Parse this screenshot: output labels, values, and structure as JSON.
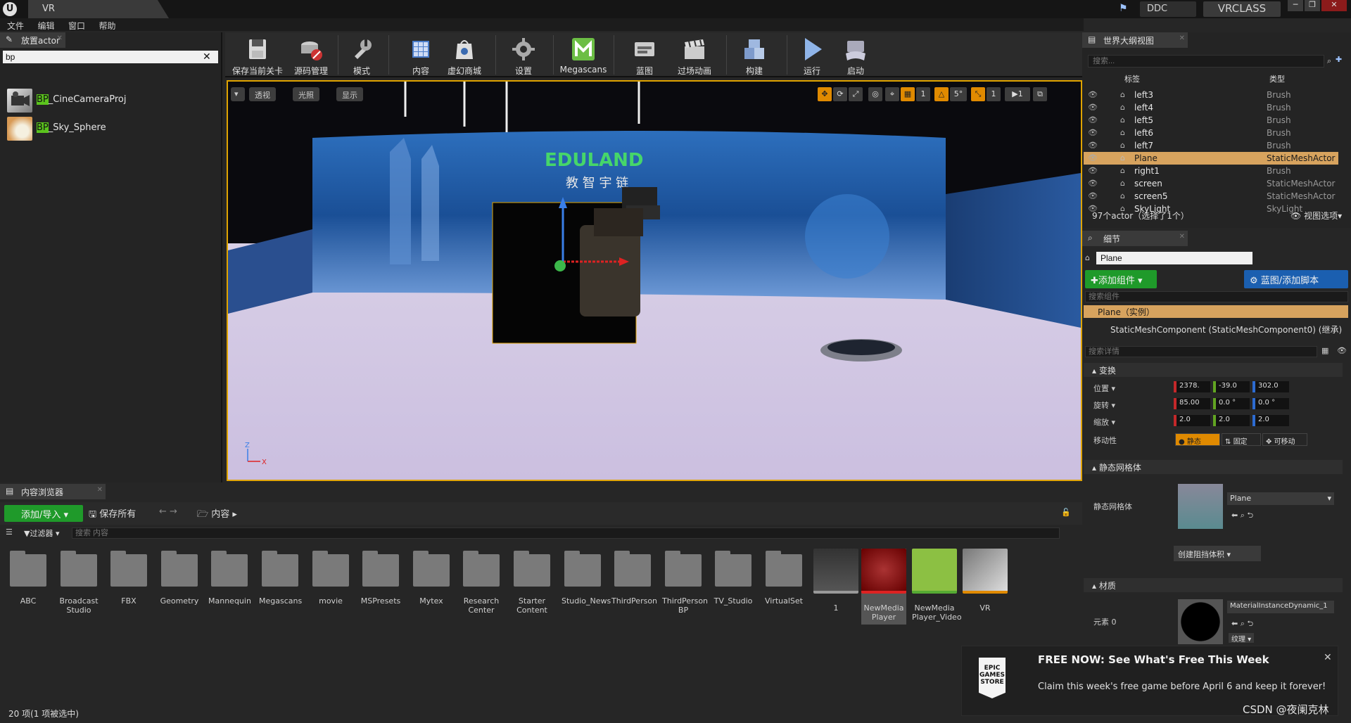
{
  "titlebar": {
    "doc_tab": "VR",
    "ddc_label": "DDC",
    "project_label": "VRCLASS",
    "min": "─",
    "max": "❐",
    "close": "✕"
  },
  "menu": [
    "文件",
    "编辑",
    "窗口",
    "帮助"
  ],
  "place_actor": {
    "tab_label": "放置actor",
    "search_value": "bp",
    "items": [
      {
        "prefix": "BP",
        "rest": "_CineCameraProj"
      },
      {
        "prefix": "BP",
        "rest": "_Sky_Sphere"
      }
    ]
  },
  "toolbar": {
    "items": [
      {
        "label": "保存当前关卡"
      },
      {
        "label": "源码管理"
      },
      {
        "label": "模式"
      },
      {
        "label": "内容"
      },
      {
        "label": "虚幻商城"
      },
      {
        "label": "设置"
      },
      {
        "label": "Megascans"
      },
      {
        "label": "蓝图"
      },
      {
        "label": "过场动画"
      },
      {
        "label": "构建"
      },
      {
        "label": "运行"
      },
      {
        "label": "启动"
      }
    ]
  },
  "viewport": {
    "perspective": "透视",
    "lighting": "光照",
    "show": "显示",
    "angle_snap": "5°",
    "grid_num": "1",
    "cam_speed": "1",
    "axis_x": "X",
    "axis_z": "Z",
    "backdrop_text": "EDULAND",
    "backdrop_sub": "教 智 宇 链"
  },
  "content_browser": {
    "tab_label": "内容浏览器",
    "add_import": "添加/导入",
    "save_all": "保存所有",
    "path": "内容",
    "filter": "过滤器",
    "search_placeholder": "搜索 内容",
    "folders": [
      [
        "ABC"
      ],
      [
        "Broadcast",
        "Studio"
      ],
      [
        "FBX"
      ],
      [
        "Geometry"
      ],
      [
        "Mannequin"
      ],
      [
        "Megascans"
      ],
      [
        "movie"
      ],
      [
        "MSPresets"
      ],
      [
        "Mytex"
      ],
      [
        "Research",
        "Center"
      ],
      [
        "Starter",
        "Content"
      ],
      [
        "Studio_News"
      ],
      [
        "ThirdPerson"
      ],
      [
        "ThirdPerson",
        "BP"
      ],
      [
        "TV_Studio"
      ],
      [
        "VirtualSet"
      ]
    ],
    "assets": [
      {
        "label": [
          "1"
        ]
      },
      {
        "label": [
          "NewMedia",
          "Player"
        ]
      },
      {
        "label": [
          "NewMedia",
          "Player_Video"
        ]
      },
      {
        "label": [
          "VR"
        ]
      }
    ],
    "status": "20 项(1 项被选中)"
  },
  "outliner": {
    "tab_label": "世界大纲视图",
    "search_placeholder": "搜索...",
    "col_label": "标签",
    "col_type": "类型",
    "rows": [
      {
        "name": "left3",
        "type": "Brush"
      },
      {
        "name": "left4",
        "type": "Brush"
      },
      {
        "name": "left5",
        "type": "Brush"
      },
      {
        "name": "left6",
        "type": "Brush"
      },
      {
        "name": "left7",
        "type": "Brush"
      },
      {
        "name": "Plane",
        "type": "StaticMeshActor",
        "selected": true
      },
      {
        "name": "right1",
        "type": "Brush"
      },
      {
        "name": "screen",
        "type": "StaticMeshActor"
      },
      {
        "name": "screen5",
        "type": "StaticMeshActor"
      },
      {
        "name": "SkyLight",
        "type": "SkyLight"
      }
    ],
    "count": "97个actor（选择了1个）",
    "view_options": "视图选项"
  },
  "details": {
    "tab_label": "细节",
    "name_value": "Plane",
    "add_component": "添加组件",
    "blueprint_script": "蓝图/添加脚本",
    "component_search": "搜索组件",
    "instance": "Plane（实例）",
    "component": "StaticMeshComponent (StaticMeshComponent0) (继承)",
    "detail_search": "搜索详情",
    "transform_section": "变换",
    "location_label": "位置",
    "rotation_label": "旋转",
    "scale_label": "缩放",
    "mobility_label": "移动性",
    "location": [
      "2378.",
      "-39.0",
      "302.0"
    ],
    "rotation": [
      "85.00",
      "0.0 °",
      "0.0 °"
    ],
    "scale": [
      "2.0",
      "2.0",
      "2.0"
    ],
    "mobility": [
      "静态",
      "固定",
      "可移动"
    ],
    "static_mesh_section": "静态网格体",
    "static_mesh_label": "静态网格体",
    "static_mesh_value": "Plane",
    "create_volume": "创建阻挡体积",
    "materials_section": "材质",
    "element_label": "元素 0",
    "material_value": "MaterialInstanceDynamic_1",
    "texture_label": "纹理"
  },
  "toast": {
    "logo_line1": "EPIC",
    "logo_line2": "GAMES",
    "logo_line3": "STORE",
    "title": "FREE NOW: See What's Free This Week",
    "body": "Claim this week's free game before April 6 and keep it forever!"
  },
  "watermark": "CSDN @夜阑克林",
  "colors": {
    "accent_green": "#1f9a2a",
    "selection": "#d7a35e",
    "viewport_border": "#e0a400",
    "blue_button": "#1b5fb0"
  }
}
